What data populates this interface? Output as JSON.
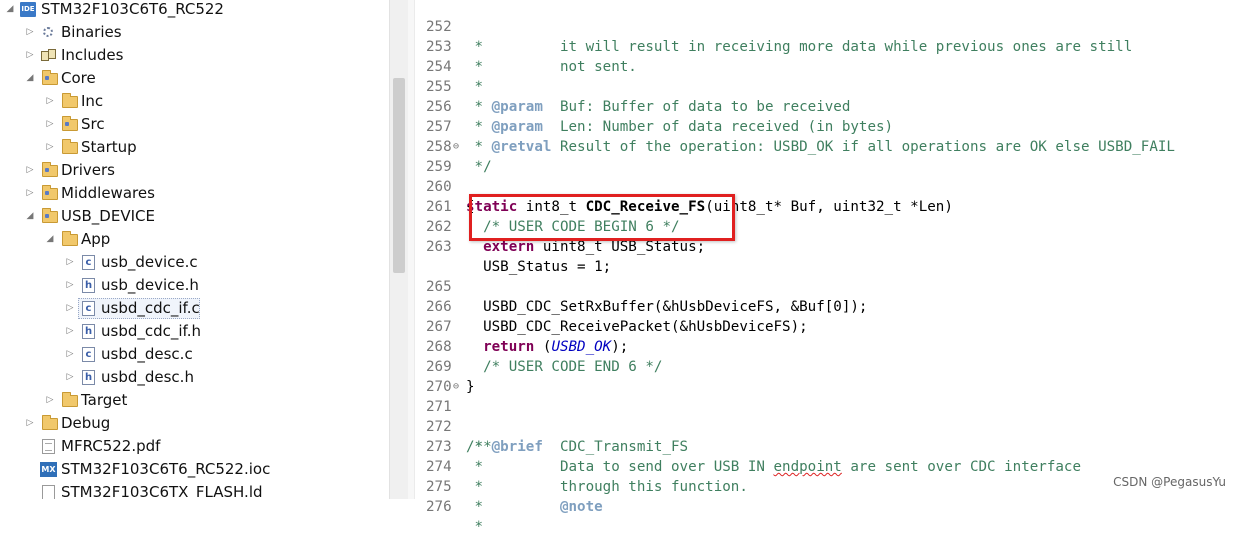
{
  "explorer": {
    "project": "STM32F103C6T6_RC522",
    "project_icon": "IDE",
    "items": [
      {
        "label": "Binaries",
        "icon": "binaries-icon"
      },
      {
        "label": "Includes",
        "icon": "includes-icon"
      },
      {
        "label": "Core",
        "icon": "folder-icon"
      },
      {
        "label": "Inc",
        "icon": "folder-icon"
      },
      {
        "label": "Src",
        "icon": "source-folder-icon"
      },
      {
        "label": "Startup",
        "icon": "folder-icon"
      },
      {
        "label": "Drivers",
        "icon": "folder-icon"
      },
      {
        "label": "Middlewares",
        "icon": "folder-icon"
      },
      {
        "label": "USB_DEVICE",
        "icon": "folder-icon"
      },
      {
        "label": "App",
        "icon": "folder-icon"
      },
      {
        "label": "usb_device.c",
        "icon": "c-file-icon",
        "glyph": "c"
      },
      {
        "label": "usb_device.h",
        "icon": "h-file-icon",
        "glyph": "h"
      },
      {
        "label": "usbd_cdc_if.c",
        "icon": "c-file-icon",
        "glyph": "c"
      },
      {
        "label": "usbd_cdc_if.h",
        "icon": "h-file-icon",
        "glyph": "h"
      },
      {
        "label": "usbd_desc.c",
        "icon": "c-file-icon",
        "glyph": "c"
      },
      {
        "label": "usbd_desc.h",
        "icon": "h-file-icon",
        "glyph": "h"
      },
      {
        "label": "Target",
        "icon": "folder-icon"
      },
      {
        "label": "Debug",
        "icon": "folder-icon"
      },
      {
        "label": "MFRC522.pdf",
        "icon": "pdf-file-icon"
      },
      {
        "label": "STM32F103C6T6_RC522.ioc",
        "icon": "mx-file-icon",
        "glyph": "MX"
      },
      {
        "label": "STM32F103C6TX_FLASH.ld",
        "icon": "ld-file-icon"
      }
    ],
    "selected": "usbd_cdc_if.c"
  },
  "code": {
    "lines": [
      {
        "n": "252",
        "text": " *         it will result in receiving more data while previous ones are still"
      },
      {
        "n": "253",
        "text": " *         not sent."
      },
      {
        "n": "254",
        "text": " *"
      },
      {
        "n": "255",
        "text": " * @param  Buf: Buffer of data to be received"
      },
      {
        "n": "256",
        "text": " * @param  Len: Number of data received (in bytes)"
      },
      {
        "n": "257",
        "text": " * @retval Result of the operation: USBD_OK if all operations are OK else USBD_FAIL"
      },
      {
        "n": "258",
        "text": " */"
      },
      {
        "n": "259",
        "text": "static int8_t CDC_Receive_FS(uint8_t* Buf, uint32_t *Len)"
      },
      {
        "n": "260",
        "text": "{"
      },
      {
        "n": "261",
        "text": "  /* USER CODE BEGIN 6 */"
      },
      {
        "n": "262",
        "text": "  extern uint8_t USB_Status;"
      },
      {
        "n": "263",
        "text": "  USB_Status = 1;"
      },
      {
        "n": "265",
        "text": "  USBD_CDC_SetRxBuffer(&hUsbDeviceFS, &Buf[0]);"
      },
      {
        "n": "266",
        "text": "  USBD_CDC_ReceivePacket(&hUsbDeviceFS);"
      },
      {
        "n": "267",
        "text": "  return (USBD_OK);"
      },
      {
        "n": "268",
        "text": "  /* USER CODE END 6 */"
      },
      {
        "n": "269",
        "text": "}"
      },
      {
        "n": "270",
        "text": ""
      },
      {
        "n": "271",
        "text": "/**"
      },
      {
        "n": "272",
        "text": " * @brief  CDC_Transmit_FS"
      },
      {
        "n": "273",
        "text": " *         Data to send over USB IN endpoint are sent over CDC interface"
      },
      {
        "n": "274",
        "text": " *         through this function."
      },
      {
        "n": "275",
        "text": " *         @note"
      },
      {
        "n": "276",
        "text": " *"
      }
    ]
  },
  "watermark": "CSDN @PegasusYu",
  "colors": {
    "keyword": "#7f0055",
    "comment": "#3f7f5f",
    "constant": "#0000c0",
    "highlight_border": "#e02020"
  }
}
